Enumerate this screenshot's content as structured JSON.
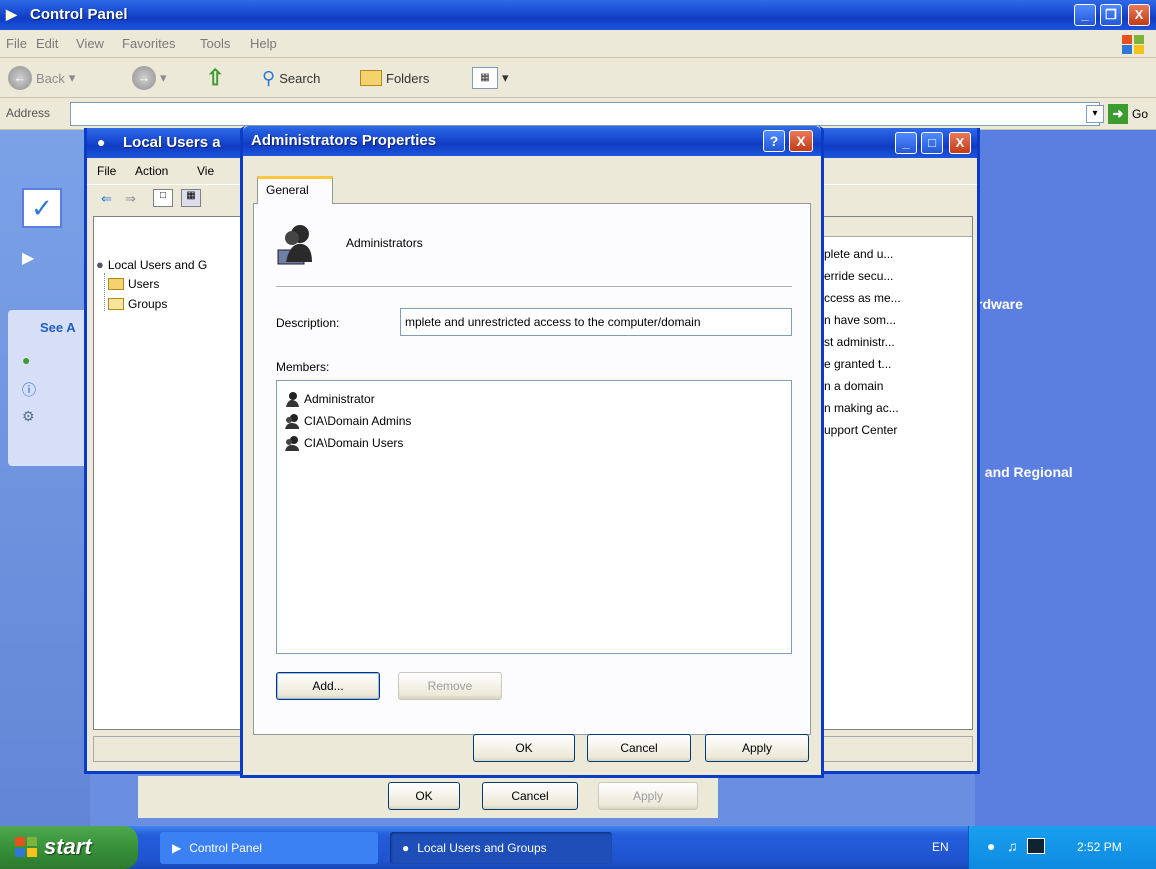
{
  "control_panel": {
    "title": "Control Panel",
    "menu": [
      "File",
      "Edit",
      "View",
      "Favorites",
      "Tools",
      "Help"
    ],
    "toolbar": {
      "back": "Back",
      "search": "Search",
      "folders": "Folders"
    },
    "address_label": "Address",
    "go_label": "Go",
    "see_also": "See A",
    "categories": [
      "rdware",
      ", and Regional"
    ]
  },
  "lug_window": {
    "title": "Local Users a",
    "menu": [
      "File",
      "Action",
      "Vie"
    ],
    "tree": {
      "root": "Local Users and G",
      "children": [
        "Users",
        "Groups"
      ]
    },
    "list_rows": [
      "plete and u...",
      "erride secu...",
      "ccess as me...",
      "n have som...",
      "st administr...",
      "e granted t...",
      "n a domain",
      "n making ac...",
      "upport Center"
    ]
  },
  "dialog": {
    "title": "Administrators Properties",
    "help_label": "?",
    "close_label": "X",
    "tab": "General",
    "group_name": "Administrators",
    "description_label": "Description:",
    "description_value": "mplete and unrestricted access to the computer/domain",
    "members_label": "Members:",
    "members": [
      "Administrator",
      "CIA\\Domain Admins",
      "CIA\\Domain Users"
    ],
    "add_button": "Add...",
    "remove_button": "Remove",
    "ok_button": "OK",
    "cancel_button": "Cancel",
    "apply_button": "Apply"
  },
  "background_dialog": {
    "ok_button": "OK",
    "cancel_button": "Cancel",
    "apply_button": "Apply"
  },
  "taskbar": {
    "start": "start",
    "tasks": [
      "Control Panel",
      "Local Users and Groups"
    ],
    "language": "EN",
    "clock": "2:52 PM"
  },
  "colors": {
    "xp_title_blue": "#0f3cc2",
    "dialog_face": "#ece9d8",
    "start_green": "#37923a",
    "close_red": "#c33a16"
  }
}
